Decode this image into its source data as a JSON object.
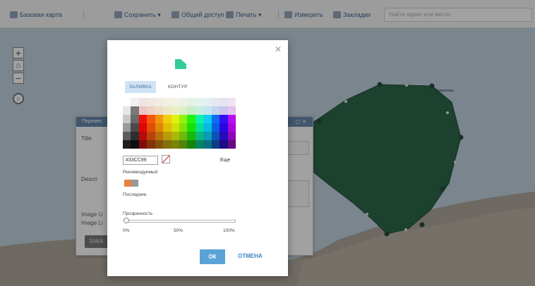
{
  "toolbar": {
    "basemap": "Базовая карта",
    "save": "Сохранить ▾",
    "share": "Общий доступ",
    "print": "Печать ▾",
    "measure": "Измерить",
    "bookmarks": "Закладки",
    "search_placeholder": "Найти адрес или место"
  },
  "map": {
    "water_color": "#bccfdc",
    "land_color": "#a59c8e",
    "polygon_fill": "#1a5a3c",
    "vertex_color": "#123d29",
    "label": "Коралловы"
  },
  "popup": {
    "title": "Перемес",
    "labels": [
      "Title",
      "Descri",
      "Image U",
      "Image Li"
    ],
    "button": "ЗАКА"
  },
  "dialog": {
    "preview_color": "#33cc99",
    "tabs": [
      "ЗАЛИВКА",
      "КОНТУР"
    ],
    "hex_value": "#33CC99",
    "more_label": "Еще",
    "recommended_label": "Рекомендуемый",
    "recommended_colors": [
      "#e8833d",
      "#999999"
    ],
    "recent_label": "Последние",
    "transparency_label": "Прозрачность",
    "transparency_value": 0,
    "slider_marks": [
      "0%",
      "50%",
      "100%"
    ],
    "ok_label": "ОК",
    "cancel_label": "ОТМЕНА"
  }
}
